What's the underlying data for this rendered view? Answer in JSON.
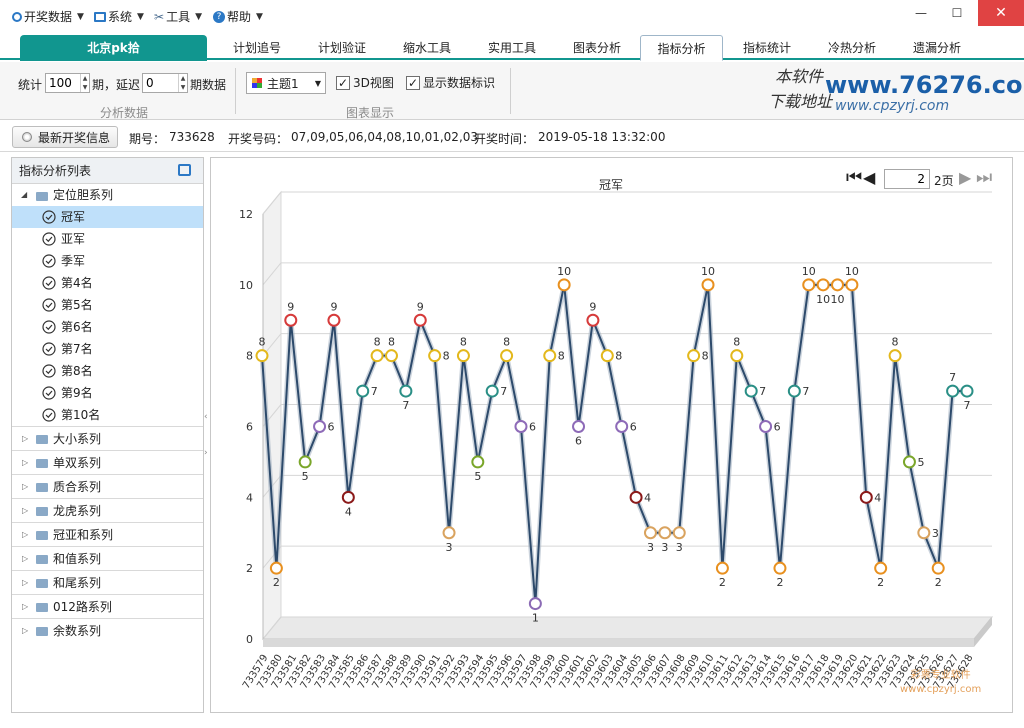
{
  "menu": {
    "items": [
      {
        "label": "开奖数据",
        "icon": "circle-icon"
      },
      {
        "label": "系统",
        "icon": "monitor-icon"
      },
      {
        "label": "工具",
        "icon": "tools-icon"
      },
      {
        "label": "帮助",
        "icon": "help-icon"
      }
    ],
    "close_glyph": "✕",
    "min_glyph": "—",
    "max_glyph": "☐"
  },
  "tabs": {
    "home": "北京pk拾",
    "items": [
      "计划追号",
      "计划验证",
      "缩水工具",
      "实用工具",
      "图表分析",
      "指标分析",
      "指标统计",
      "冷热分析",
      "遗漏分析"
    ],
    "active": "指标分析"
  },
  "toolbar": {
    "stat_label": "统计",
    "stat_value": "100",
    "period_delay_label": "期，延迟",
    "delay_value": "0",
    "period_data_label": "期数据",
    "group1_caption": "分析数据",
    "theme_value": "主题1",
    "view3d_label": "3D视图",
    "show_labels_label": "显示数据标识",
    "group2_caption": "图表显示",
    "brand_line1": "本软件",
    "brand_line2": "下载地址",
    "brand_url_big": "www.76276.com",
    "brand_url_small": "www.cpzyrj.com"
  },
  "infobar": {
    "button_label": "最新开奖信息",
    "period_label": "期号：",
    "period_value": "733628",
    "numbers_label": "开奖号码：",
    "numbers_value": "07,09,05,06,04,08,10,01,02,03",
    "time_label": "开奖时间：",
    "time_value": "2019-05-18 13:32:00"
  },
  "leftpanel": {
    "title": "指标分析列表",
    "group_open": "定位胆系列",
    "items": [
      "冠军",
      "亚军",
      "季军",
      "第4名",
      "第5名",
      "第6名",
      "第7名",
      "第8名",
      "第9名",
      "第10名"
    ],
    "selected": "冠军",
    "series": [
      "大小系列",
      "单双系列",
      "质合系列",
      "龙虎系列",
      "冠亚和系列",
      "和值系列",
      "和尾系列",
      "012路系列",
      "余数系列"
    ]
  },
  "pager": {
    "current": "2",
    "total_label": "2页"
  },
  "watermark": {
    "line1": "彩票专业软件",
    "line2": "www.cpzyrj.com"
  },
  "chart_data": {
    "type": "line",
    "title": "冠军",
    "xlabel": "",
    "ylabel": "",
    "ylim": [
      0,
      12
    ],
    "yticks": [
      0,
      2,
      4,
      6,
      8,
      10,
      12
    ],
    "grid": true,
    "view3d": true,
    "show_data_labels": true,
    "x": [
      "733579",
      "733580",
      "733581",
      "733582",
      "733583",
      "733584",
      "733585",
      "733586",
      "733587",
      "733588",
      "733589",
      "733590",
      "733591",
      "733592",
      "733593",
      "733594",
      "733595",
      "733596",
      "733597",
      "733598",
      "733599",
      "733600",
      "733601",
      "733602",
      "733603",
      "733604",
      "733605",
      "733606",
      "733607",
      "733608",
      "733609",
      "733610",
      "733611",
      "733612",
      "733613",
      "733614",
      "733615",
      "733616",
      "733617",
      "733618",
      "733619",
      "733620",
      "733621",
      "733622",
      "733623",
      "733624",
      "733625",
      "733626",
      "733627",
      "733628"
    ],
    "values": [
      8,
      2,
      9,
      5,
      6,
      9,
      4,
      7,
      8,
      8,
      7,
      9,
      8,
      3,
      8,
      5,
      7,
      8,
      6,
      1,
      8,
      10,
      6,
      9,
      8,
      6,
      4,
      3,
      3,
      3,
      8,
      10,
      2,
      8,
      7,
      6,
      2,
      7,
      10,
      10,
      10,
      10,
      4,
      2,
      8,
      5,
      3,
      2,
      7,
      7
    ],
    "marker_colors": {
      "1": "#8b6bb5",
      "2": "#e8901f",
      "3": "#d9a35f",
      "4": "#8b1a1a",
      "5": "#7aa62a",
      "6": "#8e6bb8",
      "7": "#2a8f86",
      "8": "#e3b81c",
      "9": "#d63b3b",
      "10": "#e8901f"
    },
    "line_color": "#2d4a6b"
  }
}
